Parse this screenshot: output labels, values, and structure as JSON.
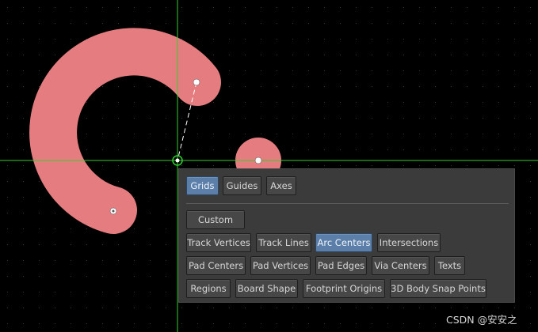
{
  "colors": {
    "background": "#000000",
    "grid_dots": "#3a3a3a",
    "crosshair": "#2fd12f",
    "copper_shape": "#e57d80",
    "panel_bg": "#3b3b3b",
    "button_active": "#5b7fa8"
  },
  "snap_panel": {
    "tabs": [
      {
        "label": "Grids",
        "active": true
      },
      {
        "label": "Guides",
        "active": false
      },
      {
        "label": "Axes",
        "active": false
      }
    ],
    "custom_label": "Custom",
    "snap_options": [
      {
        "label": "Track Vertices",
        "active": false
      },
      {
        "label": "Track Lines",
        "active": false
      },
      {
        "label": "Arc Centers",
        "active": true
      },
      {
        "label": "Intersections",
        "active": false
      },
      {
        "label": "Pad Centers",
        "active": false
      },
      {
        "label": "Pad Vertices",
        "active": false
      },
      {
        "label": "Pad Edges",
        "active": false
      },
      {
        "label": "Via Centers",
        "active": false
      },
      {
        "label": "Texts",
        "active": false
      },
      {
        "label": "Regions",
        "active": false
      },
      {
        "label": "Board Shape",
        "active": false
      },
      {
        "label": "Footprint Origins",
        "active": false
      },
      {
        "label": "3D Body Snap Points",
        "active": false
      }
    ]
  },
  "watermark": "CSDN @安安之"
}
